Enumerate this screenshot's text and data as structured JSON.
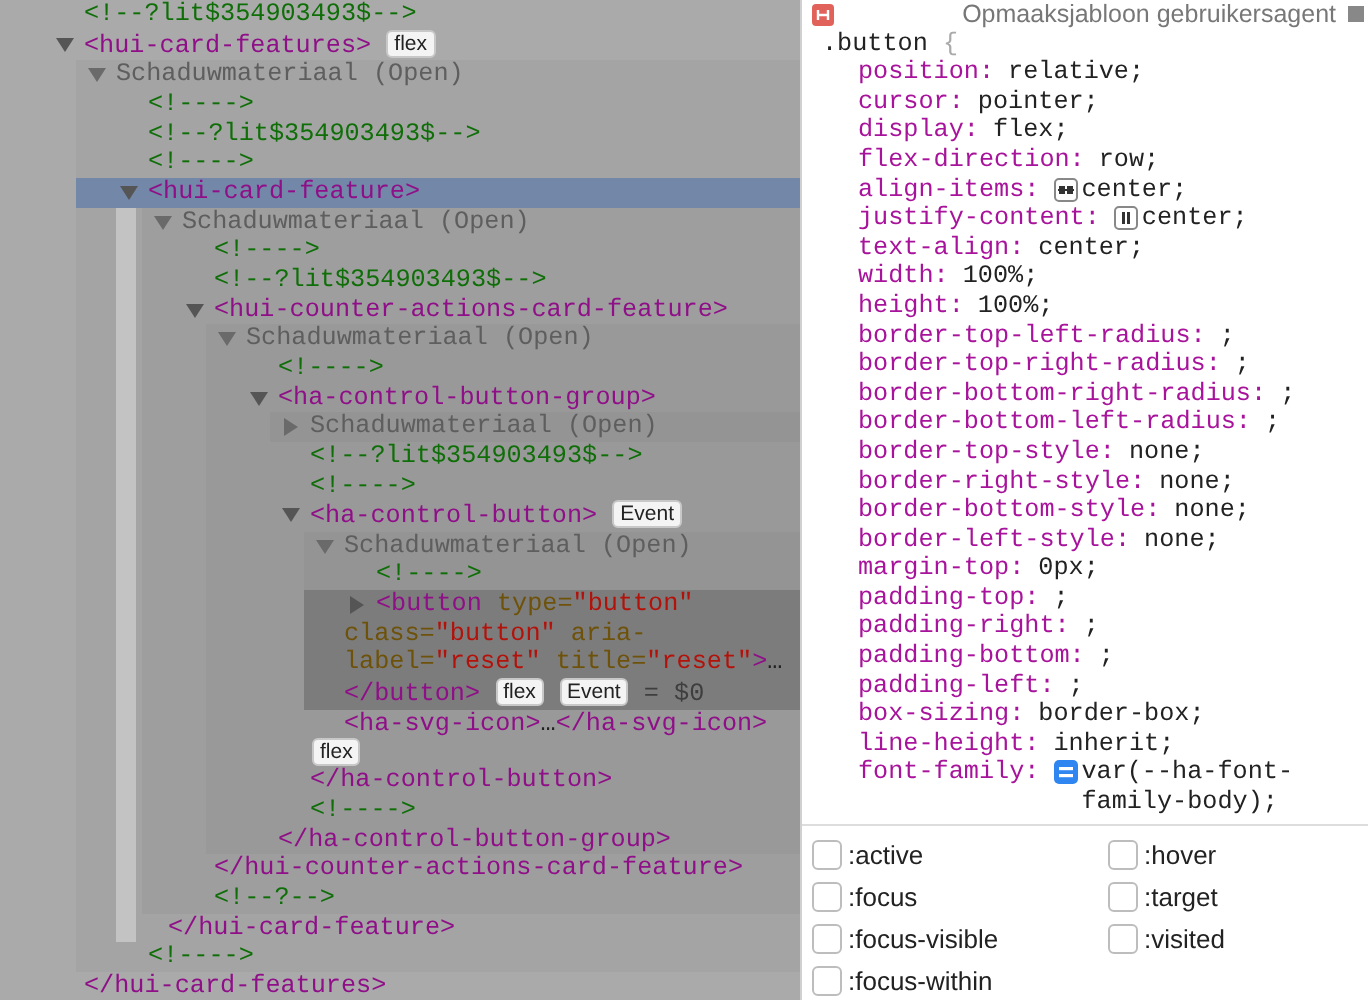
{
  "dom_tree": [
    {
      "kind": "comment",
      "text": "<!--?lit$354903493$-->"
    },
    {
      "kind": "element",
      "parts": [
        {
          "kind": "tag",
          "text": "<hui-card-features>"
        }
      ],
      "badges": [
        "flex"
      ],
      "expanded": true,
      "selected": false,
      "closing": "</hui-card-features>",
      "children": [
        {
          "kind": "shadow",
          "text": "Schaduwmateriaal (Open)",
          "expanded": true,
          "children": [
            {
              "kind": "comment",
              "text": "<!---->"
            },
            {
              "kind": "comment",
              "text": "<!--?lit$354903493$-->"
            },
            {
              "kind": "comment",
              "text": "<!---->"
            },
            {
              "kind": "element",
              "parts": [
                {
                  "kind": "tag",
                  "text": "<hui-card-feature>"
                }
              ],
              "expanded": true,
              "selected": true,
              "closing": "</hui-card-feature>",
              "children": [
                {
                  "kind": "shadow",
                  "text": "Schaduwmateriaal (Open)",
                  "expanded": true,
                  "children": [
                    {
                      "kind": "comment",
                      "text": "<!---->"
                    },
                    {
                      "kind": "comment",
                      "text": "<!--?lit$354903493$-->"
                    },
                    {
                      "kind": "element",
                      "parts": [
                        {
                          "kind": "tag",
                          "text": "<hui-counter-actions-card-feature>"
                        }
                      ],
                      "expanded": true,
                      "selected": false,
                      "closing": "</hui-counter-actions-card-feature>",
                      "children": [
                        {
                          "kind": "shadow",
                          "text": "Schaduwmateriaal (Open)",
                          "expanded": true,
                          "children": [
                            {
                              "kind": "comment",
                              "text": "<!---->"
                            },
                            {
                              "kind": "element",
                              "parts": [
                                {
                                  "kind": "tag",
                                  "text": "<ha-control-button-group>"
                                }
                              ],
                              "expanded": true,
                              "selected": false,
                              "closing": "</ha-control-button-group>",
                              "children": [
                                {
                                  "kind": "shadow",
                                  "text": "Schaduwmateriaal (Open)",
                                  "expanded": false
                                },
                                {
                                  "kind": "comment",
                                  "text": "<!--?lit$354903493$-->"
                                },
                                {
                                  "kind": "comment",
                                  "text": "<!---->"
                                },
                                {
                                  "kind": "element",
                                  "parts": [
                                    {
                                      "kind": "tag",
                                      "text": "<ha-control-button>"
                                    }
                                  ],
                                  "badges": [
                                    "Event"
                                  ],
                                  "expanded": true,
                                  "selected": false,
                                  "closing": "</ha-control-button>",
                                  "children": [
                                    {
                                      "kind": "shadow",
                                      "text": "Schaduwmateriaal (Open)",
                                      "expanded": true,
                                      "children": [
                                        {
                                          "kind": "comment",
                                          "text": "<!---->"
                                        },
                                        {
                                          "kind": "element",
                                          "parts": [
                                            {
                                              "kind": "tag",
                                              "text": "<button"
                                            },
                                            {
                                              "kind": "attr-name",
                                              "text": " type="
                                            },
                                            {
                                              "kind": "attr-value",
                                              "text": "\"button\""
                                            },
                                            {
                                              "kind": "attr-name",
                                              "text": " class="
                                            },
                                            {
                                              "kind": "attr-value",
                                              "text": "\"button\""
                                            },
                                            {
                                              "kind": "attr-name",
                                              "text": " aria-label="
                                            },
                                            {
                                              "kind": "attr-value",
                                              "text": "\"reset\""
                                            },
                                            {
                                              "kind": "attr-name",
                                              "text": " title="
                                            },
                                            {
                                              "kind": "attr-value",
                                              "text": "\"reset\""
                                            },
                                            {
                                              "kind": "tag",
                                              "text": ">"
                                            },
                                            {
                                              "kind": "plain",
                                              "text": "…"
                                            }
                                          ],
                                          "badges": [
                                            "flex",
                                            "Event"
                                          ],
                                          "expanded": false,
                                          "selected": false,
                                          "hovered": true,
                                          "closing": "</button>",
                                          "console_ref": "= $0"
                                        }
                                      ]
                                    },
                                    {
                                      "kind": "element",
                                      "parts": [
                                        {
                                          "kind": "tag",
                                          "text": "<ha-svg-icon>"
                                        },
                                        {
                                          "kind": "plain",
                                          "text": "…"
                                        },
                                        {
                                          "kind": "tag",
                                          "text": "</ha-svg-icon>"
                                        }
                                      ],
                                      "badges": [
                                        "flex"
                                      ],
                                      "selected": false
                                    }
                                  ]
                                },
                                {
                                  "kind": "comment",
                                  "text": "<!---->"
                                }
                              ]
                            }
                          ]
                        }
                      ]
                    },
                    {
                      "kind": "comment",
                      "text": "<!--?-->"
                    }
                  ]
                }
              ]
            },
            {
              "kind": "comment",
              "text": "<!---->"
            }
          ]
        }
      ]
    }
  ],
  "style_rule": {
    "source": "Opmaaksjabloon gebruikersagent",
    "selector": ".button",
    "brace": "{",
    "declarations": [
      {
        "kind": "plain",
        "name": "position:",
        "value": "relative;"
      },
      {
        "kind": "plain",
        "name": "cursor:",
        "value": "pointer;"
      },
      {
        "kind": "plain",
        "name": "display:",
        "value": "flex;"
      },
      {
        "kind": "plain",
        "name": "flex-direction:",
        "value": "row;"
      },
      {
        "kind": "align",
        "name": "align-items:",
        "value": "center;"
      },
      {
        "kind": "justify",
        "name": "justify-content:",
        "value": "center;"
      },
      {
        "kind": "plain",
        "name": "text-align:",
        "value": "center;"
      },
      {
        "kind": "plain",
        "name": "width:",
        "value": "100%;"
      },
      {
        "kind": "plain",
        "name": "height:",
        "value": "100%;"
      },
      {
        "kind": "plain",
        "name": "border-top-left-radius:",
        "value": ";"
      },
      {
        "kind": "plain",
        "name": "border-top-right-radius:",
        "value": ";"
      },
      {
        "kind": "plain",
        "name": "border-bottom-right-radius:",
        "value": ";"
      },
      {
        "kind": "plain",
        "name": "border-bottom-left-radius:",
        "value": ";"
      },
      {
        "kind": "plain",
        "name": "border-top-style:",
        "value": "none;"
      },
      {
        "kind": "plain",
        "name": "border-right-style:",
        "value": "none;"
      },
      {
        "kind": "plain",
        "name": "border-bottom-style:",
        "value": "none;"
      },
      {
        "kind": "plain",
        "name": "border-left-style:",
        "value": "none;"
      },
      {
        "kind": "plain",
        "name": "margin-top:",
        "value": "0px;"
      },
      {
        "kind": "plain",
        "name": "padding-top:",
        "value": ";"
      },
      {
        "kind": "plain",
        "name": "padding-right:",
        "value": ";"
      },
      {
        "kind": "plain",
        "name": "padding-bottom:",
        "value": ";"
      },
      {
        "kind": "plain",
        "name": "padding-left:",
        "value": ";"
      },
      {
        "kind": "plain",
        "name": "box-sizing:",
        "value": "border-box;"
      },
      {
        "kind": "plain",
        "name": "line-height:",
        "value": "inherit;"
      },
      {
        "kind": "variable",
        "name": "font-family:",
        "value": "var(--ha-font-family-body);"
      }
    ]
  },
  "pseudo_classes": [
    {
      "label": ":active",
      "checked": false
    },
    {
      "label": ":hover",
      "checked": false
    },
    {
      "label": ":focus",
      "checked": false
    },
    {
      "label": ":target",
      "checked": false
    },
    {
      "label": ":focus-visible",
      "checked": false
    },
    {
      "label": ":visited",
      "checked": false
    },
    {
      "label": ":focus-within",
      "checked": false
    }
  ]
}
